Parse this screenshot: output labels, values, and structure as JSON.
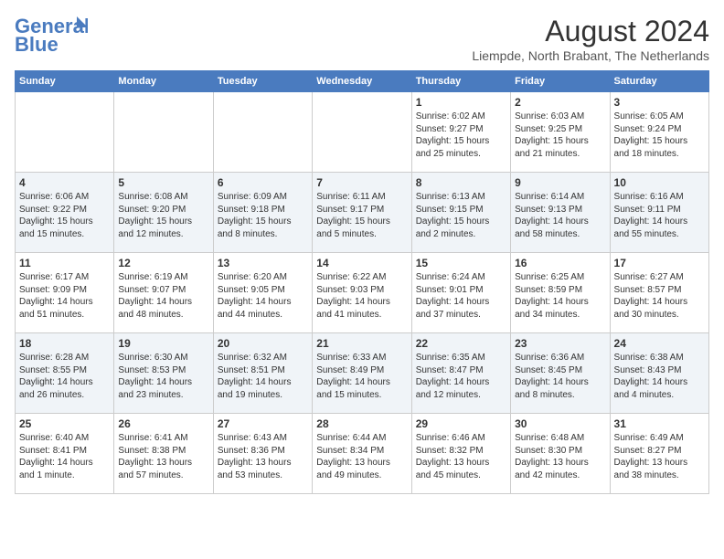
{
  "logo": {
    "line1": "General",
    "line2": "Blue"
  },
  "title": "August 2024",
  "subtitle": "Liempde, North Brabant, The Netherlands",
  "weekdays": [
    "Sunday",
    "Monday",
    "Tuesday",
    "Wednesday",
    "Thursday",
    "Friday",
    "Saturday"
  ],
  "weeks": [
    [
      {
        "day": "",
        "info": ""
      },
      {
        "day": "",
        "info": ""
      },
      {
        "day": "",
        "info": ""
      },
      {
        "day": "",
        "info": ""
      },
      {
        "day": "1",
        "info": "Sunrise: 6:02 AM\nSunset: 9:27 PM\nDaylight: 15 hours\nand 25 minutes."
      },
      {
        "day": "2",
        "info": "Sunrise: 6:03 AM\nSunset: 9:25 PM\nDaylight: 15 hours\nand 21 minutes."
      },
      {
        "day": "3",
        "info": "Sunrise: 6:05 AM\nSunset: 9:24 PM\nDaylight: 15 hours\nand 18 minutes."
      }
    ],
    [
      {
        "day": "4",
        "info": "Sunrise: 6:06 AM\nSunset: 9:22 PM\nDaylight: 15 hours\nand 15 minutes."
      },
      {
        "day": "5",
        "info": "Sunrise: 6:08 AM\nSunset: 9:20 PM\nDaylight: 15 hours\nand 12 minutes."
      },
      {
        "day": "6",
        "info": "Sunrise: 6:09 AM\nSunset: 9:18 PM\nDaylight: 15 hours\nand 8 minutes."
      },
      {
        "day": "7",
        "info": "Sunrise: 6:11 AM\nSunset: 9:17 PM\nDaylight: 15 hours\nand 5 minutes."
      },
      {
        "day": "8",
        "info": "Sunrise: 6:13 AM\nSunset: 9:15 PM\nDaylight: 15 hours\nand 2 minutes."
      },
      {
        "day": "9",
        "info": "Sunrise: 6:14 AM\nSunset: 9:13 PM\nDaylight: 14 hours\nand 58 minutes."
      },
      {
        "day": "10",
        "info": "Sunrise: 6:16 AM\nSunset: 9:11 PM\nDaylight: 14 hours\nand 55 minutes."
      }
    ],
    [
      {
        "day": "11",
        "info": "Sunrise: 6:17 AM\nSunset: 9:09 PM\nDaylight: 14 hours\nand 51 minutes."
      },
      {
        "day": "12",
        "info": "Sunrise: 6:19 AM\nSunset: 9:07 PM\nDaylight: 14 hours\nand 48 minutes."
      },
      {
        "day": "13",
        "info": "Sunrise: 6:20 AM\nSunset: 9:05 PM\nDaylight: 14 hours\nand 44 minutes."
      },
      {
        "day": "14",
        "info": "Sunrise: 6:22 AM\nSunset: 9:03 PM\nDaylight: 14 hours\nand 41 minutes."
      },
      {
        "day": "15",
        "info": "Sunrise: 6:24 AM\nSunset: 9:01 PM\nDaylight: 14 hours\nand 37 minutes."
      },
      {
        "day": "16",
        "info": "Sunrise: 6:25 AM\nSunset: 8:59 PM\nDaylight: 14 hours\nand 34 minutes."
      },
      {
        "day": "17",
        "info": "Sunrise: 6:27 AM\nSunset: 8:57 PM\nDaylight: 14 hours\nand 30 minutes."
      }
    ],
    [
      {
        "day": "18",
        "info": "Sunrise: 6:28 AM\nSunset: 8:55 PM\nDaylight: 14 hours\nand 26 minutes."
      },
      {
        "day": "19",
        "info": "Sunrise: 6:30 AM\nSunset: 8:53 PM\nDaylight: 14 hours\nand 23 minutes."
      },
      {
        "day": "20",
        "info": "Sunrise: 6:32 AM\nSunset: 8:51 PM\nDaylight: 14 hours\nand 19 minutes."
      },
      {
        "day": "21",
        "info": "Sunrise: 6:33 AM\nSunset: 8:49 PM\nDaylight: 14 hours\nand 15 minutes."
      },
      {
        "day": "22",
        "info": "Sunrise: 6:35 AM\nSunset: 8:47 PM\nDaylight: 14 hours\nand 12 minutes."
      },
      {
        "day": "23",
        "info": "Sunrise: 6:36 AM\nSunset: 8:45 PM\nDaylight: 14 hours\nand 8 minutes."
      },
      {
        "day": "24",
        "info": "Sunrise: 6:38 AM\nSunset: 8:43 PM\nDaylight: 14 hours\nand 4 minutes."
      }
    ],
    [
      {
        "day": "25",
        "info": "Sunrise: 6:40 AM\nSunset: 8:41 PM\nDaylight: 14 hours\nand 1 minute."
      },
      {
        "day": "26",
        "info": "Sunrise: 6:41 AM\nSunset: 8:38 PM\nDaylight: 13 hours\nand 57 minutes."
      },
      {
        "day": "27",
        "info": "Sunrise: 6:43 AM\nSunset: 8:36 PM\nDaylight: 13 hours\nand 53 minutes."
      },
      {
        "day": "28",
        "info": "Sunrise: 6:44 AM\nSunset: 8:34 PM\nDaylight: 13 hours\nand 49 minutes."
      },
      {
        "day": "29",
        "info": "Sunrise: 6:46 AM\nSunset: 8:32 PM\nDaylight: 13 hours\nand 45 minutes."
      },
      {
        "day": "30",
        "info": "Sunrise: 6:48 AM\nSunset: 8:30 PM\nDaylight: 13 hours\nand 42 minutes."
      },
      {
        "day": "31",
        "info": "Sunrise: 6:49 AM\nSunset: 8:27 PM\nDaylight: 13 hours\nand 38 minutes."
      }
    ]
  ]
}
